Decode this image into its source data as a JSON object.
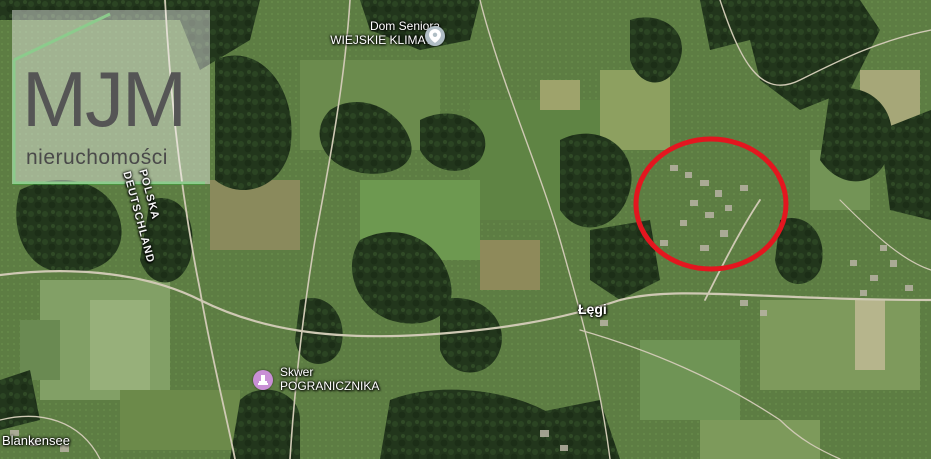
{
  "map": {
    "poi_seniors": {
      "line1": "Dom Seniora",
      "line2": "WIEJSKIE KLIMATY",
      "icon": "location-pin-icon",
      "pin_color": "#b0bec5"
    },
    "poi_square": {
      "line1": "Skwer",
      "line2": "POGRANICZNIKA",
      "icon": "monument-pin-icon",
      "pin_color": "#c98fd6"
    },
    "town": "Łęgi",
    "town_west": "Blankensee",
    "border_pl": "POLSKA",
    "border_de": "DEUTSCHLAND",
    "highlight_color": "#e3161f"
  },
  "logo": {
    "mark": "MJM",
    "subtitle": "nieruchomości",
    "accent_color": "#3aa63a"
  }
}
